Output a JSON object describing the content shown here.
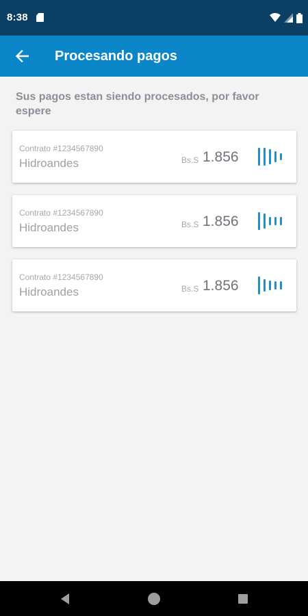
{
  "status_bar": {
    "time": "8:38",
    "icons": [
      "sd-card-icon",
      "wifi-icon",
      "cellular-signal-icon",
      "battery-icon"
    ]
  },
  "app_bar": {
    "title": "Procesando pagos",
    "back_icon": "arrow-left-icon"
  },
  "subtitle": "Sus pagos estan siendo procesados, por favor espere",
  "payments": [
    {
      "contract": "Contrato #1234567890",
      "company": "Hidroandes",
      "currency": "Bs.S",
      "amount": "1.856",
      "status_icon": "processing-loader-icon"
    },
    {
      "contract": "Contrato #1234567890",
      "company": "Hidroandes",
      "currency": "Bs.S",
      "amount": "1.856",
      "status_icon": "processing-loader-icon"
    },
    {
      "contract": "Contrato #1234567890",
      "company": "Hidroandes",
      "currency": "Bs.S",
      "amount": "1.856",
      "status_icon": "processing-loader-icon"
    }
  ],
  "nav_bar": {
    "icons": [
      "back-triangle-icon",
      "home-circle-icon",
      "recents-square-icon"
    ]
  },
  "colors": {
    "status_bar": "#0b3f63",
    "app_bar": "#0b86c9",
    "accent": "#1f8fd0",
    "background": "#f3f3f3"
  }
}
